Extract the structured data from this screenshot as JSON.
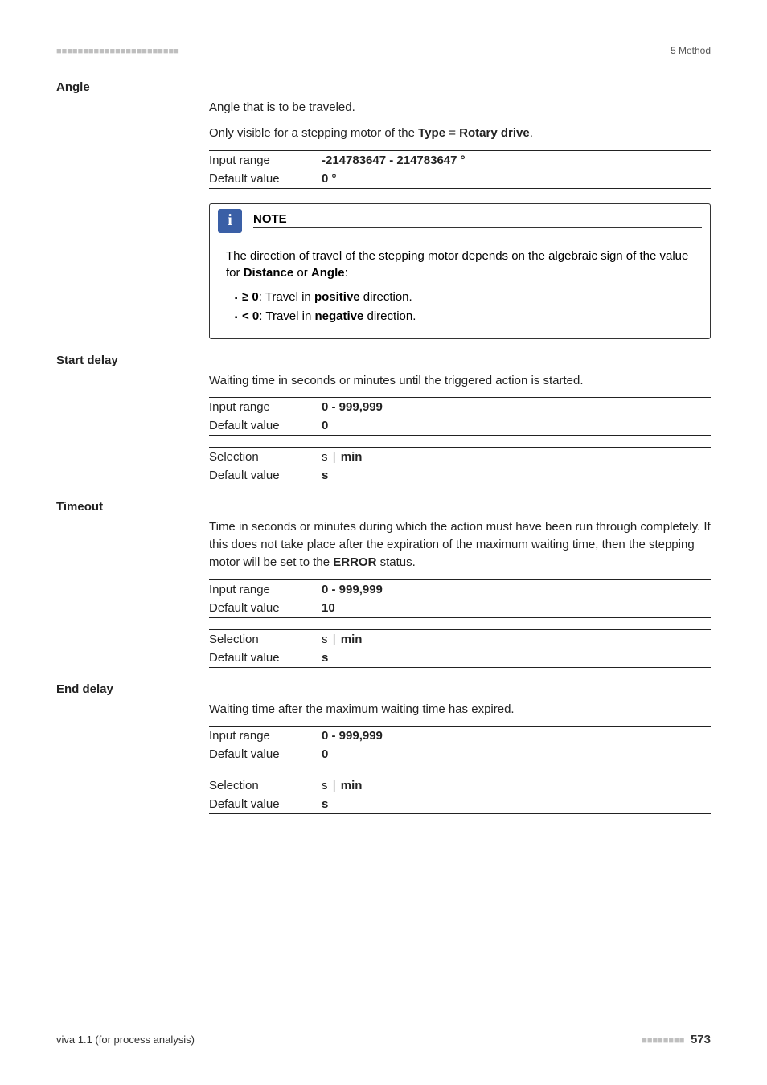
{
  "header": {
    "dashes": "■■■■■■■■■■■■■■■■■■■■■■■",
    "right": "5 Method"
  },
  "angle": {
    "label": "Angle",
    "desc": "Angle that is to be traveled.",
    "visible_prefix": "Only visible for a stepping motor of the ",
    "visible_type": "Type",
    "visible_eq": " = ",
    "visible_rotary": "Rotary drive",
    "visible_suffix": ".",
    "rows": [
      {
        "label": "Input range",
        "value": "-214783647 - 214783647 °"
      },
      {
        "label": "Default value",
        "value": "0 °"
      }
    ]
  },
  "note": {
    "title": "NOTE",
    "icon": "i",
    "line1_a": "The direction of travel of the stepping motor depends on the algebraic sign of the value for ",
    "line1_b": "Distance",
    "line1_c": " or ",
    "line1_d": "Angle",
    "line1_e": ":",
    "bullets": [
      {
        "sym": "≥ 0",
        "mid": ": Travel in ",
        "dir": "positive",
        "end": " direction."
      },
      {
        "sym": "< 0",
        "mid": ": Travel in ",
        "dir": "negative",
        "end": " direction."
      }
    ]
  },
  "start_delay": {
    "label": "Start delay",
    "desc": "Waiting time in seconds or minutes until the triggered action is started.",
    "group1": [
      {
        "label": "Input range",
        "value": "0 - 999,999"
      },
      {
        "label": "Default value",
        "value": "0"
      }
    ],
    "group2": [
      {
        "label": "Selection",
        "v1": "s",
        "sep": " | ",
        "v2": "min"
      },
      {
        "label": "Default value",
        "value": "s"
      }
    ]
  },
  "timeout": {
    "label": "Timeout",
    "desc_a": "Time in seconds or minutes during which the action must have been run through completely. If this does not take place after the expiration of the maximum waiting time, then the stepping motor will be set to the ",
    "desc_b": "ERROR",
    "desc_c": " status.",
    "group1": [
      {
        "label": "Input range",
        "value": "0 - 999,999"
      },
      {
        "label": "Default value",
        "value": "10"
      }
    ],
    "group2": [
      {
        "label": "Selection",
        "v1": "s",
        "sep": " | ",
        "v2": "min"
      },
      {
        "label": "Default value",
        "value": "s"
      }
    ]
  },
  "end_delay": {
    "label": "End delay",
    "desc": "Waiting time after the maximum waiting time has expired.",
    "group1": [
      {
        "label": "Input range",
        "value": "0 - 999,999"
      },
      {
        "label": "Default value",
        "value": "0"
      }
    ],
    "group2": [
      {
        "label": "Selection",
        "v1": "s",
        "sep": " | ",
        "v2": "min"
      },
      {
        "label": "Default value",
        "value": "s"
      }
    ]
  },
  "footer": {
    "left": "viva 1.1 (for process analysis)",
    "dashes": "■■■■■■■■",
    "page": "573"
  }
}
